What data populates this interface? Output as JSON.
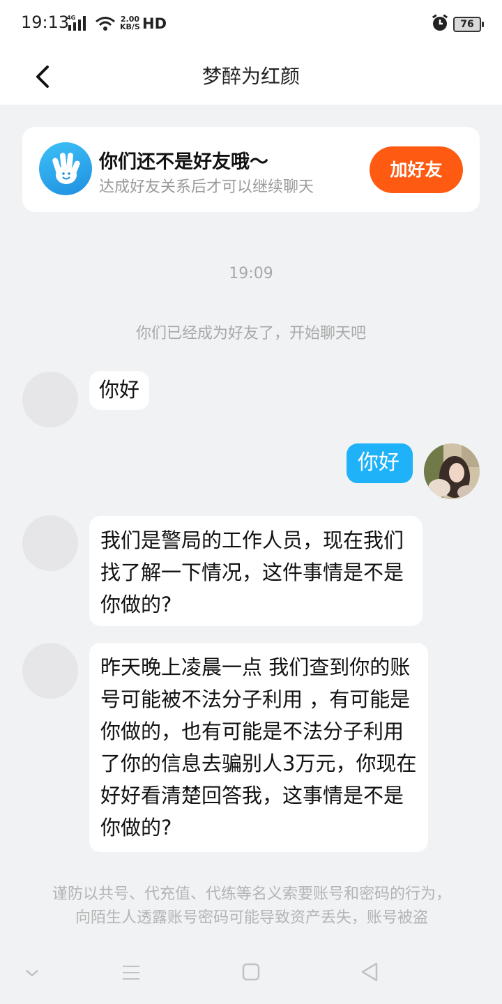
{
  "status_bar": {
    "time": "19:13",
    "network": "4G",
    "speed_value": "2.00",
    "speed_unit": "KB/S",
    "hd": "HD",
    "battery": "76"
  },
  "header": {
    "title": "梦醉为红颜"
  },
  "friend_banner": {
    "title": "你们还不是好友哦～",
    "subtitle": "达成好友关系后才可以继续聊天",
    "button": "加好友"
  },
  "chat": {
    "timestamp": "19:09",
    "system_message": "你们已经成为好友了，开始聊天吧",
    "messages": [
      {
        "side": "left",
        "text": "你好"
      },
      {
        "side": "right",
        "text": "你好"
      },
      {
        "side": "left",
        "text": "我们是警局的工作人员，现在我们找了解一下情况，这件事情是不是你做的?"
      },
      {
        "side": "left",
        "text": "昨天晚上凌晨一点 我们查到你的账号可能被不法分子利用 ，有可能是你做的，也有可能是不法分子利用了你的信息去骗别人3万元，你现在好好看清楚回答我，这事情是不是你做的?"
      }
    ]
  },
  "warning": "谨防以共号、代充值、代练等名义索要账号和密码的行为，向陌生人透露账号密码可能导致资产丢失，账号被盗",
  "colors": {
    "accent_blue": "#1fb2f8",
    "add_button": "#fe5a12",
    "background": "#f1f2f4"
  },
  "icons": [
    "back-arrow-icon",
    "hand-wave-icon",
    "alarm-icon",
    "signal-icon",
    "wifi-icon",
    "nav-down-icon",
    "nav-menu-icon",
    "nav-home-icon",
    "nav-back-icon"
  ]
}
